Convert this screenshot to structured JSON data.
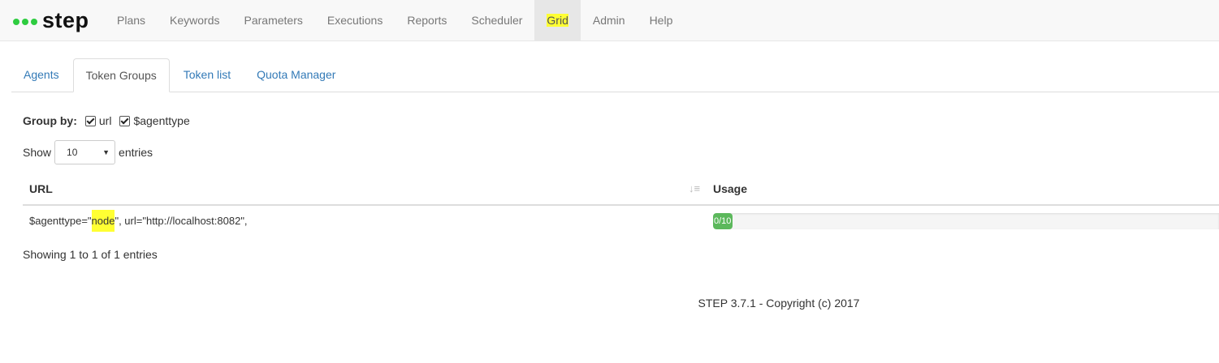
{
  "app": {
    "brand": "step",
    "brand_color": "#2ecc40"
  },
  "nav": {
    "items": [
      {
        "label": "Plans"
      },
      {
        "label": "Keywords"
      },
      {
        "label": "Parameters"
      },
      {
        "label": "Executions"
      },
      {
        "label": "Reports"
      },
      {
        "label": "Scheduler"
      },
      {
        "label": "Grid",
        "active": true
      },
      {
        "label": "Admin"
      },
      {
        "label": "Help"
      }
    ]
  },
  "tabs": {
    "items": [
      {
        "label": "Agents"
      },
      {
        "label": "Token Groups",
        "active": true
      },
      {
        "label": "Token list"
      },
      {
        "label": "Quota Manager"
      }
    ]
  },
  "group_by": {
    "label": "Group by:",
    "options": [
      {
        "label": "url",
        "checked": true
      },
      {
        "label": "$agenttype",
        "checked": true
      }
    ]
  },
  "page_length": {
    "prefix": "Show",
    "value": "10",
    "suffix": "entries"
  },
  "table": {
    "headers": {
      "url": "URL",
      "usage": "Usage"
    },
    "rows": [
      {
        "url_prefix": "$agenttype=\"",
        "url_highlight": "node",
        "url_suffix": "\", url=\"http://localhost:8082\",",
        "usage_label": "0/10",
        "usage_fraction": 0.0
      }
    ]
  },
  "info": "Showing 1 to 1 of 1 entries",
  "footer": "STEP 3.7.1 - Copyright (c) 2017",
  "colors": {
    "highlight": "#ffff33",
    "progress": "#5cb85c",
    "link": "#337ab7"
  }
}
